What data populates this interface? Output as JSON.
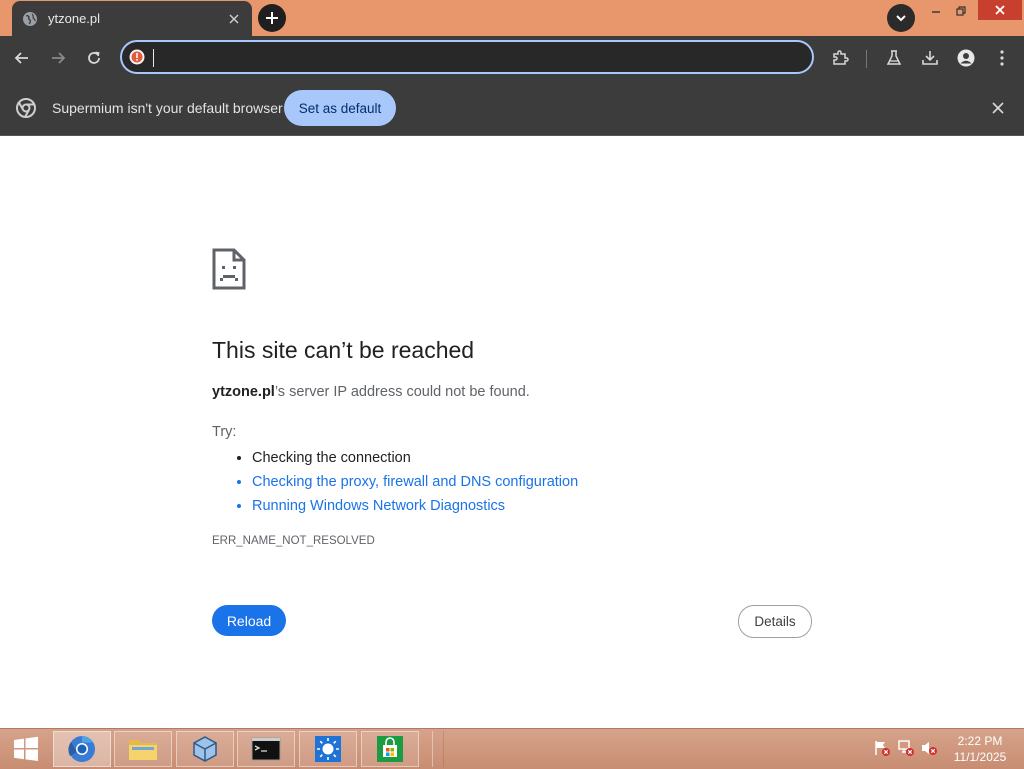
{
  "tab": {
    "title": "ytzone.pl"
  },
  "omnibox": {
    "value": "",
    "placeholder": ""
  },
  "infobar": {
    "message": "Supermium isn't your default browser",
    "button": "Set as default"
  },
  "error": {
    "title": "This site can’t be reached",
    "host": "ytzone.pl",
    "host_suffix": "’s server IP address could not be found.",
    "try_label": "Try:",
    "suggestions": [
      "Checking the connection",
      "Checking the proxy, firewall and DNS configuration",
      "Running Windows Network Diagnostics"
    ],
    "code": "ERR_NAME_NOT_RESOLVED",
    "reload": "Reload",
    "details": "Details"
  },
  "taskbar": {
    "time": "2:22 PM",
    "date": "11/1/2025",
    "apps": [
      "chromium-icon",
      "file-explorer-icon",
      "virtualbox-icon",
      "command-prompt-icon",
      "weather-icon",
      "store-icon"
    ]
  },
  "colors": {
    "titlebar": "#e8966b",
    "toolbar": "#3c3c3c",
    "accent": "#a8c7fa",
    "link": "#1a73e8",
    "close": "#c7402f"
  }
}
